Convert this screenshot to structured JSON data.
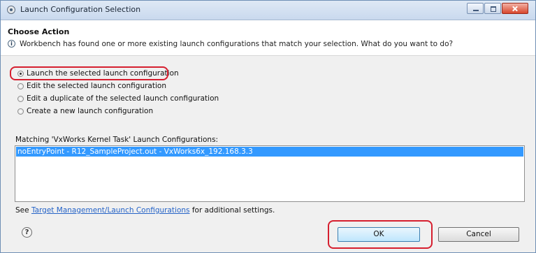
{
  "window": {
    "title": "Launch Configuration Selection"
  },
  "header": {
    "title": "Choose Action",
    "message": "Workbench has found one or more existing launch configurations that match your selection. What do you want to do?"
  },
  "options": [
    {
      "label": "Launch the selected launch configuration",
      "checked": true
    },
    {
      "label": "Edit the selected launch configuration",
      "checked": false
    },
    {
      "label": "Edit a duplicate of the selected launch configuration",
      "checked": false
    },
    {
      "label": "Create a new launch configuration",
      "checked": false
    }
  ],
  "configs": {
    "label": "Matching 'VxWorks Kernel Task' Launch Configurations:",
    "selected": "noEntryPoint - R12_SampleProject.out - VxWorks6x_192.168.3.3"
  },
  "footer": {
    "see": "See",
    "link": "Target Management/Launch Configurations",
    "after": "for additional settings."
  },
  "buttons": {
    "help": "?",
    "ok": "OK",
    "cancel": "Cancel"
  }
}
